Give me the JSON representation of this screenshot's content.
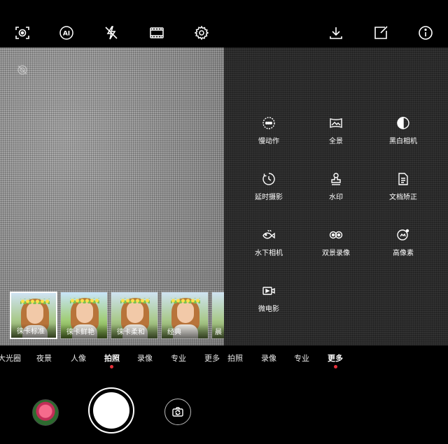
{
  "top_toolbar": {
    "icons": [
      "focus-frame-icon",
      "ai-icon",
      "flash-off-icon",
      "film-aspect-icon",
      "gear-icon",
      "download-icon",
      "edit-icon",
      "info-icon"
    ]
  },
  "filters": [
    {
      "label": "徕卡标准",
      "selected": true
    },
    {
      "label": "徕卡鲜艳",
      "selected": false
    },
    {
      "label": "徕卡柔和",
      "selected": false
    },
    {
      "label": "经典",
      "selected": false
    },
    {
      "label": "晨",
      "selected": false
    }
  ],
  "mode_tabs_left": [
    "大光圈",
    "夜景",
    "人像",
    "拍照",
    "录像",
    "专业",
    "更多"
  ],
  "mode_tabs_left_active": "拍照",
  "mode_tabs_right": [
    "拍照",
    "录像",
    "专业",
    "更多"
  ],
  "mode_tabs_right_active": "更多",
  "more_modes": [
    {
      "label": "慢动作",
      "icon": "slow-motion-icon"
    },
    {
      "label": "全景",
      "icon": "panorama-icon"
    },
    {
      "label": "黑白相机",
      "icon": "monochrome-icon"
    },
    {
      "label": "延时摄影",
      "icon": "timelapse-icon"
    },
    {
      "label": "水印",
      "icon": "watermark-stamp-icon"
    },
    {
      "label": "文档矫正",
      "icon": "document-correction-icon"
    },
    {
      "label": "水下相机",
      "icon": "underwater-fish-icon"
    },
    {
      "label": "双景录像",
      "icon": "dual-view-icon"
    },
    {
      "label": "高像素",
      "icon": "high-resolution-icon"
    },
    {
      "label": "微电影",
      "icon": "micro-movie-icon"
    }
  ],
  "accent_color": "#e6313b"
}
